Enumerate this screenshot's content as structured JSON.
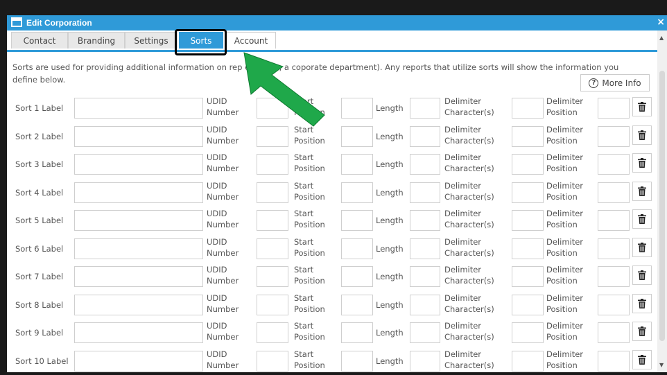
{
  "window": {
    "title": "Edit Corporation",
    "close": "×"
  },
  "tabs": [
    {
      "label": "Contact",
      "active": false
    },
    {
      "label": "Branding",
      "active": false
    },
    {
      "label": "Settings",
      "active": false
    },
    {
      "label": "Sorts",
      "active": true
    },
    {
      "label": "Account",
      "active": false
    }
  ],
  "description": "Sorts are used for providing additional information on rep          example, a coporate department). Any reports that utilize sorts will show the information you define below.",
  "more_info_label": "More Info",
  "field_labels": {
    "udid_line1": "UDID",
    "udid_line2": "Number",
    "start_line1": "Start",
    "start_line2": "Position",
    "start_line2_row1": "Position",
    "length": "Length",
    "delim_char_line1": "Delimiter",
    "delim_char_line2": "Character(s)",
    "delim_pos_line1": "Delimiter",
    "delim_pos_line2": "Position"
  },
  "rows": [
    {
      "label": "Sort 1 Label"
    },
    {
      "label": "Sort 2 Label"
    },
    {
      "label": "Sort 3 Label"
    },
    {
      "label": "Sort 4 Label"
    },
    {
      "label": "Sort 5 Label"
    },
    {
      "label": "Sort 6 Label"
    },
    {
      "label": "Sort 7 Label"
    },
    {
      "label": "Sort 8 Label"
    },
    {
      "label": "Sort 9 Label"
    },
    {
      "label": "Sort 10 Label"
    }
  ],
  "colors": {
    "accent": "#2f9ad8",
    "arrow": "#1fa84a",
    "highlight": "#000000"
  },
  "icons": {
    "trash": "trash-icon",
    "info": "question-circle-icon",
    "window": "window-icon",
    "close": "close-icon"
  }
}
